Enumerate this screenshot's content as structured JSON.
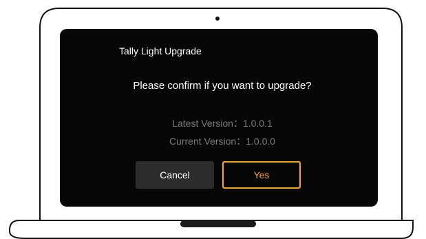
{
  "dialog": {
    "title": "Tally Light Upgrade",
    "message": "Please confirm if you want to upgrade?",
    "latest_version_label": "Latest Version",
    "latest_version_value": "1.0.0.1",
    "current_version_label": "Current Version",
    "current_version_value": "1.0.0.0",
    "separator": "：",
    "cancel_label": "Cancel",
    "confirm_label": "Yes"
  },
  "colors": {
    "screen_background": "#070707",
    "accent": "#f5a623",
    "cancel_button": "#2c2c2c",
    "muted_text": "#7c7c7c"
  },
  "icons": {
    "device": "laptop-outline-icon",
    "camera": "webcam-dot-icon"
  }
}
